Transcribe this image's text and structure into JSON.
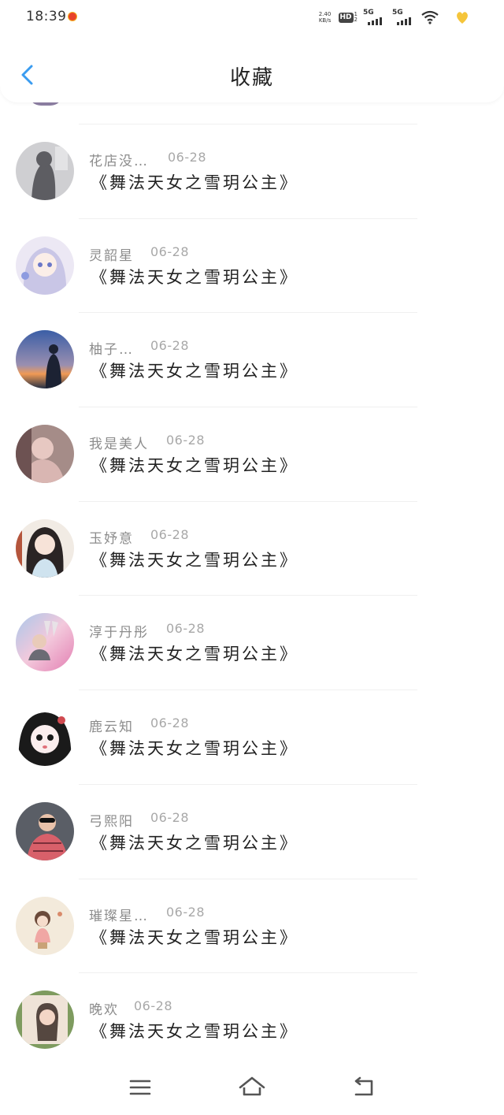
{
  "status": {
    "time": "18:39",
    "net_speed_top": "2.40",
    "net_speed_bottom": "KB/s",
    "hd_label": "HD",
    "hd_sub_top": "1",
    "hd_sub_bottom": "2",
    "sim1_label": "5G",
    "sim2_label": "5G"
  },
  "header": {
    "title": "收藏",
    "back_icon": "chevron-left-icon"
  },
  "items": [
    {
      "name": "花店没…",
      "date": "06-28",
      "message": "《舞法天女之雪玥公主》",
      "avatar_colors": [
        "#c9c9cc",
        "#6e6e72"
      ]
    },
    {
      "name": "灵韶星",
      "date": "06-28",
      "message": "《舞法天女之雪玥公主》",
      "avatar_colors": [
        "#e7e2f2",
        "#8f8cc9"
      ]
    },
    {
      "name": "柚子…",
      "date": "06-28",
      "message": "《舞法天女之雪玥公主》",
      "avatar_colors": [
        "#3f5f9c",
        "#e98a4f"
      ]
    },
    {
      "name": "我是美人",
      "date": "06-28",
      "message": "《舞法天女之雪玥公主》",
      "avatar_colors": [
        "#b89b94",
        "#6b4a4a"
      ]
    },
    {
      "name": "玉妤意",
      "date": "06-28",
      "message": "《舞法天女之雪玥公主》",
      "avatar_colors": [
        "#f3ece6",
        "#2b2b2b"
      ]
    },
    {
      "name": "淳于丹彤",
      "date": "06-28",
      "message": "《舞法天女之雪玥公主》",
      "avatar_colors": [
        "#e9a6c7",
        "#a9c8e8"
      ]
    },
    {
      "name": "鹿云知",
      "date": "06-28",
      "message": "《舞法天女之雪玥公主》",
      "avatar_colors": [
        "#ffffff",
        "#1a1a1a"
      ]
    },
    {
      "name": "弓熙阳",
      "date": "06-28",
      "message": "《舞法天女之雪玥公主》",
      "avatar_colors": [
        "#d95f6b",
        "#3a3a3a"
      ]
    },
    {
      "name": "璀璨星…",
      "date": "06-28",
      "message": "《舞法天女之雪玥公主》",
      "avatar_colors": [
        "#f1e6cf",
        "#d98b6b"
      ]
    },
    {
      "name": "晚欢",
      "date": "06-28",
      "message": "《舞法天女之雪玥公主》",
      "avatar_colors": [
        "#7c9a5a",
        "#efe2d6"
      ]
    }
  ],
  "nav": {
    "menu_icon": "menu-icon",
    "home_icon": "home-icon",
    "back_icon": "back-arrow-icon"
  },
  "colors": {
    "accent": "#3a9cf0",
    "text_primary": "#222222",
    "text_secondary": "#8c8c8c",
    "divider": "#f0f0f0"
  }
}
